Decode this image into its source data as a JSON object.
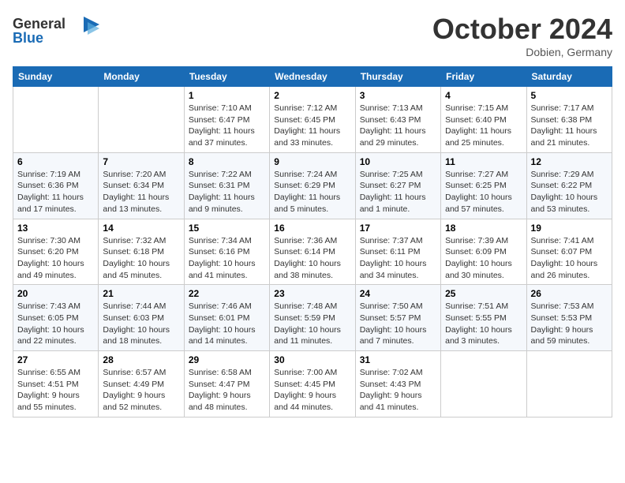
{
  "header": {
    "logo_line1": "General",
    "logo_line2": "Blue",
    "month": "October 2024",
    "location": "Dobien, Germany"
  },
  "weekdays": [
    "Sunday",
    "Monday",
    "Tuesday",
    "Wednesday",
    "Thursday",
    "Friday",
    "Saturday"
  ],
  "weeks": [
    [
      {
        "day": "",
        "detail": ""
      },
      {
        "day": "",
        "detail": ""
      },
      {
        "day": "1",
        "detail": "Sunrise: 7:10 AM\nSunset: 6:47 PM\nDaylight: 11 hours and 37 minutes."
      },
      {
        "day": "2",
        "detail": "Sunrise: 7:12 AM\nSunset: 6:45 PM\nDaylight: 11 hours and 33 minutes."
      },
      {
        "day": "3",
        "detail": "Sunrise: 7:13 AM\nSunset: 6:43 PM\nDaylight: 11 hours and 29 minutes."
      },
      {
        "day": "4",
        "detail": "Sunrise: 7:15 AM\nSunset: 6:40 PM\nDaylight: 11 hours and 25 minutes."
      },
      {
        "day": "5",
        "detail": "Sunrise: 7:17 AM\nSunset: 6:38 PM\nDaylight: 11 hours and 21 minutes."
      }
    ],
    [
      {
        "day": "6",
        "detail": "Sunrise: 7:19 AM\nSunset: 6:36 PM\nDaylight: 11 hours and 17 minutes."
      },
      {
        "day": "7",
        "detail": "Sunrise: 7:20 AM\nSunset: 6:34 PM\nDaylight: 11 hours and 13 minutes."
      },
      {
        "day": "8",
        "detail": "Sunrise: 7:22 AM\nSunset: 6:31 PM\nDaylight: 11 hours and 9 minutes."
      },
      {
        "day": "9",
        "detail": "Sunrise: 7:24 AM\nSunset: 6:29 PM\nDaylight: 11 hours and 5 minutes."
      },
      {
        "day": "10",
        "detail": "Sunrise: 7:25 AM\nSunset: 6:27 PM\nDaylight: 11 hours and 1 minute."
      },
      {
        "day": "11",
        "detail": "Sunrise: 7:27 AM\nSunset: 6:25 PM\nDaylight: 10 hours and 57 minutes."
      },
      {
        "day": "12",
        "detail": "Sunrise: 7:29 AM\nSunset: 6:22 PM\nDaylight: 10 hours and 53 minutes."
      }
    ],
    [
      {
        "day": "13",
        "detail": "Sunrise: 7:30 AM\nSunset: 6:20 PM\nDaylight: 10 hours and 49 minutes."
      },
      {
        "day": "14",
        "detail": "Sunrise: 7:32 AM\nSunset: 6:18 PM\nDaylight: 10 hours and 45 minutes."
      },
      {
        "day": "15",
        "detail": "Sunrise: 7:34 AM\nSunset: 6:16 PM\nDaylight: 10 hours and 41 minutes."
      },
      {
        "day": "16",
        "detail": "Sunrise: 7:36 AM\nSunset: 6:14 PM\nDaylight: 10 hours and 38 minutes."
      },
      {
        "day": "17",
        "detail": "Sunrise: 7:37 AM\nSunset: 6:11 PM\nDaylight: 10 hours and 34 minutes."
      },
      {
        "day": "18",
        "detail": "Sunrise: 7:39 AM\nSunset: 6:09 PM\nDaylight: 10 hours and 30 minutes."
      },
      {
        "day": "19",
        "detail": "Sunrise: 7:41 AM\nSunset: 6:07 PM\nDaylight: 10 hours and 26 minutes."
      }
    ],
    [
      {
        "day": "20",
        "detail": "Sunrise: 7:43 AM\nSunset: 6:05 PM\nDaylight: 10 hours and 22 minutes."
      },
      {
        "day": "21",
        "detail": "Sunrise: 7:44 AM\nSunset: 6:03 PM\nDaylight: 10 hours and 18 minutes."
      },
      {
        "day": "22",
        "detail": "Sunrise: 7:46 AM\nSunset: 6:01 PM\nDaylight: 10 hours and 14 minutes."
      },
      {
        "day": "23",
        "detail": "Sunrise: 7:48 AM\nSunset: 5:59 PM\nDaylight: 10 hours and 11 minutes."
      },
      {
        "day": "24",
        "detail": "Sunrise: 7:50 AM\nSunset: 5:57 PM\nDaylight: 10 hours and 7 minutes."
      },
      {
        "day": "25",
        "detail": "Sunrise: 7:51 AM\nSunset: 5:55 PM\nDaylight: 10 hours and 3 minutes."
      },
      {
        "day": "26",
        "detail": "Sunrise: 7:53 AM\nSunset: 5:53 PM\nDaylight: 9 hours and 59 minutes."
      }
    ],
    [
      {
        "day": "27",
        "detail": "Sunrise: 6:55 AM\nSunset: 4:51 PM\nDaylight: 9 hours and 55 minutes."
      },
      {
        "day": "28",
        "detail": "Sunrise: 6:57 AM\nSunset: 4:49 PM\nDaylight: 9 hours and 52 minutes."
      },
      {
        "day": "29",
        "detail": "Sunrise: 6:58 AM\nSunset: 4:47 PM\nDaylight: 9 hours and 48 minutes."
      },
      {
        "day": "30",
        "detail": "Sunrise: 7:00 AM\nSunset: 4:45 PM\nDaylight: 9 hours and 44 minutes."
      },
      {
        "day": "31",
        "detail": "Sunrise: 7:02 AM\nSunset: 4:43 PM\nDaylight: 9 hours and 41 minutes."
      },
      {
        "day": "",
        "detail": ""
      },
      {
        "day": "",
        "detail": ""
      }
    ]
  ]
}
